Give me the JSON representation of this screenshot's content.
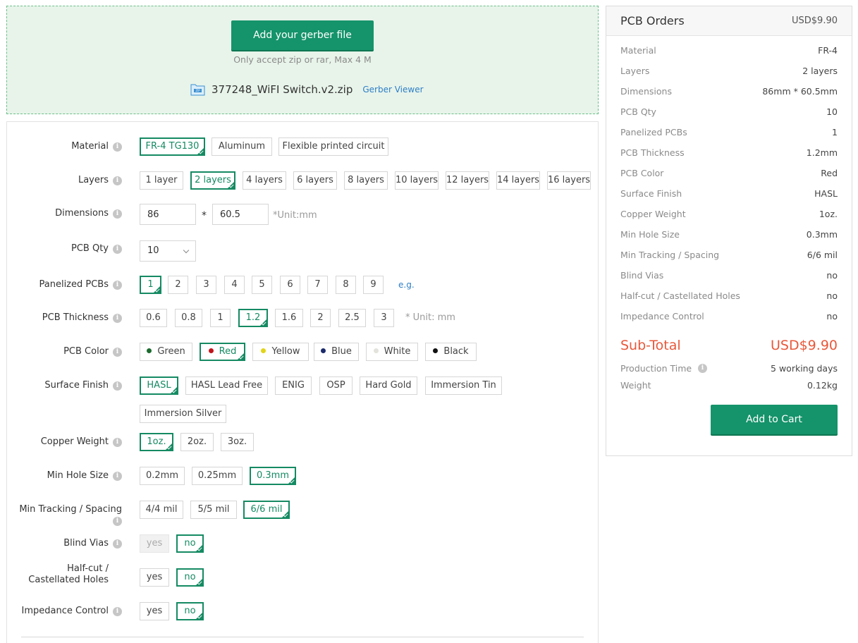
{
  "upload": {
    "button_label": "Add your gerber file",
    "note": "Only accept zip or rar, Max 4 M",
    "file_name": "377248_WiFI Switch.v2.zip",
    "viewer_link": "Gerber Viewer",
    "file_icon": "zip-file-icon"
  },
  "form": {
    "material": {
      "label": "Material",
      "options": [
        "FR-4 TG130",
        "Aluminum",
        "Flexible printed circuit"
      ],
      "selected": "FR-4 TG130"
    },
    "layers": {
      "label": "Layers",
      "options": [
        "1 layer",
        "2 layers",
        "4 layers",
        "6 layers",
        "8 layers",
        "10 layers",
        "12 layers",
        "14 layers",
        "16 layers"
      ],
      "selected": "2 layers"
    },
    "dimensions": {
      "label": "Dimensions",
      "width": "86",
      "height": "60.5",
      "separator": "*",
      "unit": "*Unit:mm"
    },
    "qty": {
      "label": "PCB Qty",
      "value": "10"
    },
    "panelized": {
      "label": "Panelized PCBs",
      "options": [
        "1",
        "2",
        "3",
        "4",
        "5",
        "6",
        "7",
        "8",
        "9"
      ],
      "selected": "1",
      "eg_link": "e.g."
    },
    "thickness": {
      "label": "PCB Thickness",
      "options": [
        "0.6",
        "0.8",
        "1",
        "1.2",
        "1.6",
        "2",
        "2.5",
        "3"
      ],
      "selected": "1.2",
      "unit": "* Unit: mm"
    },
    "color": {
      "label": "PCB Color",
      "options": [
        "Green",
        "Red",
        "Yellow",
        "Blue",
        "White",
        "Black"
      ],
      "dots": [
        "#1b6b2e",
        "#c0141a",
        "#e2d41a",
        "#1a2a6a",
        "#e3e3dc",
        "#111111"
      ],
      "selected": "Red"
    },
    "finish": {
      "label": "Surface Finish",
      "options": [
        "HASL",
        "HASL Lead Free",
        "ENIG",
        "OSP",
        "Hard Gold",
        "Immersion Tin",
        "Immersion Silver"
      ],
      "selected": "HASL"
    },
    "copper": {
      "label": "Copper Weight",
      "options": [
        "1oz.",
        "2oz.",
        "3oz."
      ],
      "selected": "1oz."
    },
    "hole": {
      "label": "Min Hole Size",
      "options": [
        "0.2mm",
        "0.25mm",
        "0.3mm"
      ],
      "selected": "0.3mm"
    },
    "tracking": {
      "label": "Min Tracking / Spacing",
      "options": [
        "4/4 mil",
        "5/5 mil",
        "6/6 mil"
      ],
      "selected": "6/6 mil"
    },
    "blind": {
      "label": "Blind Vias",
      "options": [
        "yes",
        "no"
      ],
      "selected": "no",
      "disabled": "yes"
    },
    "halfcut": {
      "label_line1": "Half-cut /",
      "label_line2": "Castellated Holes",
      "options": [
        "yes",
        "no"
      ],
      "selected": "no"
    },
    "impedance": {
      "label": "Impedance Control",
      "options": [
        "yes",
        "no"
      ],
      "selected": "no"
    }
  },
  "summary": {
    "title": "PCB Orders",
    "price": "USD$9.90",
    "rows": [
      {
        "k": "Material",
        "v": "FR-4"
      },
      {
        "k": "Layers",
        "v": "2 layers"
      },
      {
        "k": "Dimensions",
        "v": "86mm * 60.5mm"
      },
      {
        "k": "PCB Qty",
        "v": "10"
      },
      {
        "k": "Panelized PCBs",
        "v": "1"
      },
      {
        "k": "PCB Thickness",
        "v": "1.2mm"
      },
      {
        "k": "PCB Color",
        "v": "Red"
      },
      {
        "k": "Surface Finish",
        "v": "HASL"
      },
      {
        "k": "Copper Weight",
        "v": "1oz."
      },
      {
        "k": "Min Hole Size",
        "v": "0.3mm"
      },
      {
        "k": "Min Tracking / Spacing",
        "v": "6/6 mil"
      },
      {
        "k": "Blind Vias",
        "v": "no"
      },
      {
        "k": "Half-cut / Castellated Holes",
        "v": "no"
      },
      {
        "k": "Impedance Control",
        "v": "no"
      }
    ],
    "subtotal_label": "Sub-Total",
    "subtotal_value": "USD$9.90",
    "production_label": "Production Time",
    "production_value": "5 working days",
    "weight_label": "Weight",
    "weight_value": "0.12kg",
    "cart_button": "Add to Cart",
    "accent_color": "#15936a",
    "price_color": "#e8583a"
  }
}
